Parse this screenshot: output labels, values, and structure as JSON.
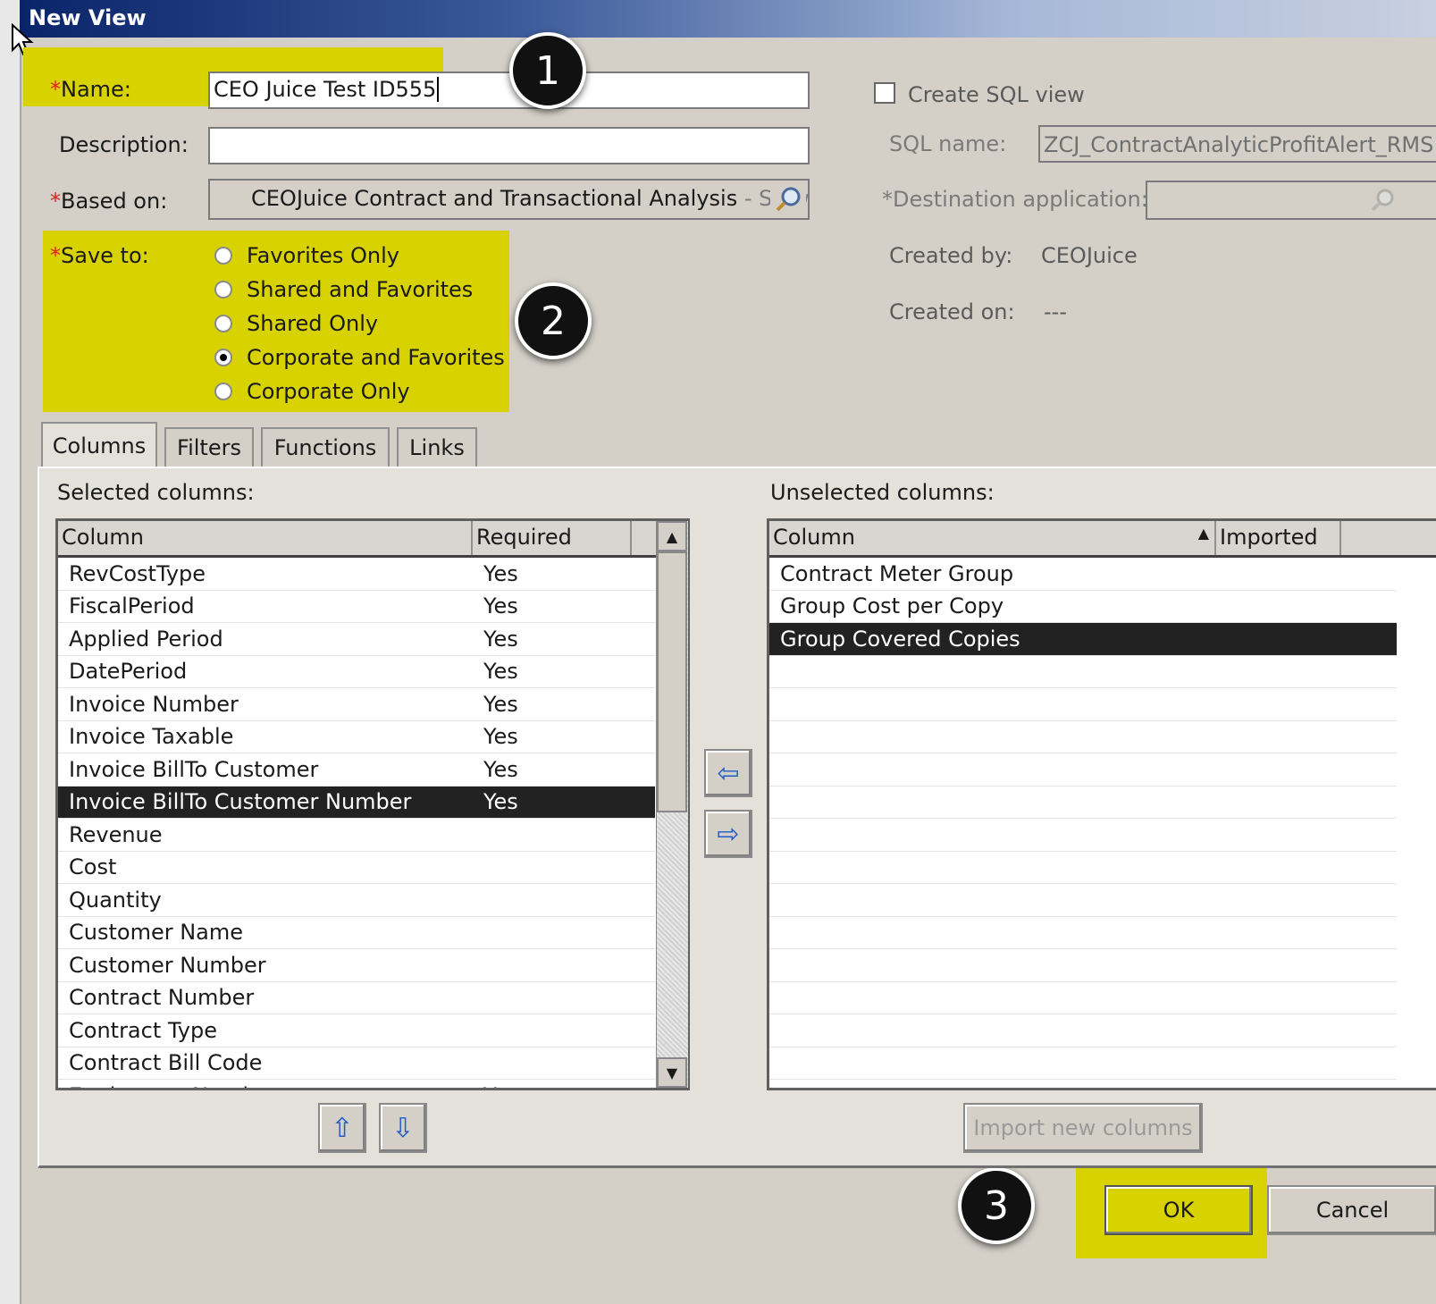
{
  "window": {
    "title": "New View"
  },
  "form": {
    "name_label": "Name:",
    "name_value": "CEO Juice Test ID555",
    "description_label": "Description:",
    "description_value": "",
    "based_on_label": "Based on:",
    "based_on_value": "CEOJuice Contract and Transactional Analysis",
    "based_on_suffix": "- Shows",
    "save_to_label": "Save to:",
    "save_to_options": [
      {
        "label": "Favorites Only",
        "selected": false
      },
      {
        "label": "Shared and Favorites",
        "selected": false
      },
      {
        "label": "Shared Only",
        "selected": false
      },
      {
        "label": "Corporate and Favorites",
        "selected": true
      },
      {
        "label": "Corporate Only",
        "selected": false
      }
    ],
    "required_marker": "*"
  },
  "right_panel": {
    "create_sql_label": "Create SQL view",
    "create_sql_checked": false,
    "sql_name_label": "SQL name:",
    "sql_name_value": "ZCJ_ContractAnalyticProfitAlert_RMS",
    "dest_app_label": "Destination application:",
    "dest_app_value": "",
    "created_by_label": "Created by:",
    "created_by_value": "CEOJuice",
    "created_on_label": "Created on:",
    "created_on_value": "---"
  },
  "tabs": [
    "Columns",
    "Filters",
    "Functions",
    "Links"
  ],
  "active_tab": "Columns",
  "selected_columns": {
    "title": "Selected columns:",
    "headers": [
      "Column",
      "Required"
    ],
    "rows": [
      {
        "column": "RevCostType",
        "required": "Yes",
        "selected": false
      },
      {
        "column": "FiscalPeriod",
        "required": "Yes",
        "selected": false
      },
      {
        "column": "Applied Period",
        "required": "Yes",
        "selected": false
      },
      {
        "column": "DatePeriod",
        "required": "Yes",
        "selected": false
      },
      {
        "column": "Invoice Number",
        "required": "Yes",
        "selected": false
      },
      {
        "column": "Invoice Taxable",
        "required": "Yes",
        "selected": false
      },
      {
        "column": "Invoice BillTo Customer",
        "required": "Yes",
        "selected": false
      },
      {
        "column": "Invoice BillTo Customer Number",
        "required": "Yes",
        "selected": true
      },
      {
        "column": "Revenue",
        "required": "",
        "selected": false
      },
      {
        "column": "Cost",
        "required": "",
        "selected": false
      },
      {
        "column": "Quantity",
        "required": "",
        "selected": false
      },
      {
        "column": "Customer Name",
        "required": "",
        "selected": false
      },
      {
        "column": "Customer Number",
        "required": "",
        "selected": false
      },
      {
        "column": "Contract Number",
        "required": "",
        "selected": false
      },
      {
        "column": "Contract Type",
        "required": "",
        "selected": false
      },
      {
        "column": "Contract Bill Code",
        "required": "",
        "selected": false
      },
      {
        "column": "Equipment Number",
        "required": "Yes",
        "selected": false
      }
    ]
  },
  "unselected_columns": {
    "title": "Unselected columns:",
    "headers": [
      "Column",
      "Imported"
    ],
    "rows": [
      {
        "column": "Contract Meter Group",
        "imported": "",
        "selected": false
      },
      {
        "column": "Group Cost per Copy",
        "imported": "",
        "selected": false
      },
      {
        "column": "Group Covered Copies",
        "imported": "",
        "selected": true
      }
    ],
    "empty_rows": 14
  },
  "buttons": {
    "import_new_columns": "Import new columns",
    "ok": "OK",
    "cancel": "Cancel"
  },
  "annotations": [
    "1",
    "2",
    "3"
  ],
  "colors": {
    "highlight": "#d8d300",
    "titlebar": "#0a246a",
    "selection": "#222222"
  }
}
